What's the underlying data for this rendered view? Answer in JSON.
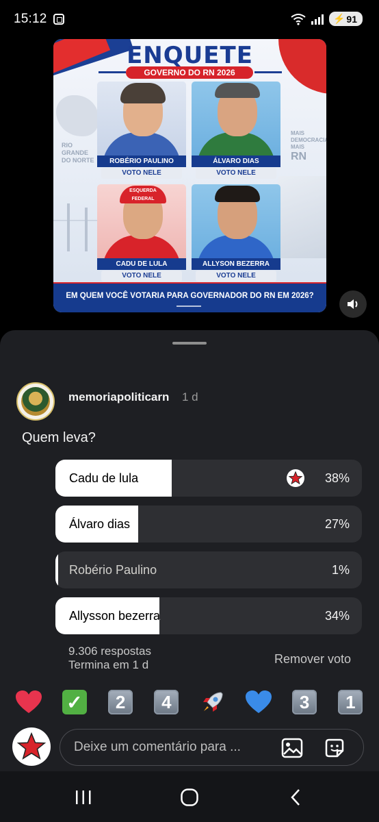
{
  "status": {
    "time": "15:12",
    "battery": "91"
  },
  "story": {
    "title": "ENQUETE",
    "subtitle": "GOVERNO DO RN 2026",
    "side_left": "RIO GRANDE DO NORTE",
    "side_right_small": "MAIS DEMOCRACIA MAIS",
    "side_right_big": "RN",
    "cap_text": "ESQUERDA FEDERAL",
    "cards": [
      {
        "name": "ROBÉRIO PAULINO",
        "vote": "VOTO NELE"
      },
      {
        "name": "ÁLVARO DIAS",
        "vote": "VOTO NELE"
      },
      {
        "name": "CADU DE LULA",
        "vote": "VOTO NELE"
      },
      {
        "name": "ALLYSON BEZERRA",
        "vote": "VOTO NELE"
      }
    ],
    "question": "EM QUEM VOCÊ VOTARIA PARA GOVERNADOR DO RN EM 2026?"
  },
  "post": {
    "username": "memoriapoliticarn",
    "time": "1 d",
    "question": "Quem leva?"
  },
  "poll": {
    "options": [
      {
        "label": "Cadu de lula",
        "percent_text": "38%",
        "percent": 38,
        "selected": true
      },
      {
        "label": "Álvaro dias",
        "percent_text": "27%",
        "percent": 27,
        "selected": false
      },
      {
        "label": "Robério Paulino",
        "percent_text": "1%",
        "percent": 1,
        "selected": false
      },
      {
        "label": "Allysson bezerra",
        "percent_text": "34%",
        "percent": 34,
        "selected": false
      }
    ],
    "responses": "9.306 respostas",
    "ends": "Termina em 1 d",
    "remove_vote": "Remover voto"
  },
  "reactions": [
    "heart",
    "check",
    "2",
    "4",
    "rocket",
    "blue-heart",
    "3",
    "1"
  ],
  "compose": {
    "placeholder": "Deixe um comentário para ..."
  },
  "colors": {
    "sheet": "#1e1f23",
    "poll_bg": "#2e2f33",
    "poll_fill": "#ffffff",
    "star": "#d8232a"
  }
}
